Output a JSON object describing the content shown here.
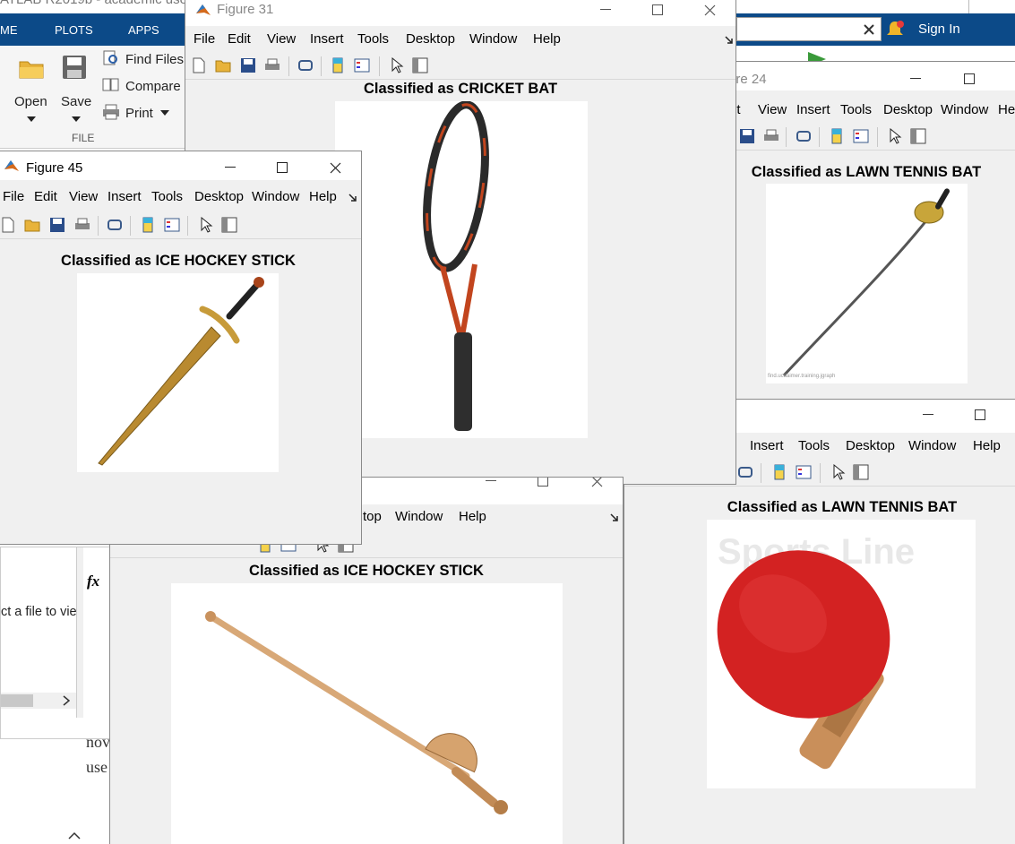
{
  "matlab": {
    "title": "ATLAB R2019b - academic use",
    "tabs": [
      "ME",
      "PLOTS",
      "APPS"
    ],
    "buttons": {
      "open": "Open",
      "save": "Save",
      "find_files": "Find Files",
      "compare": "Compare",
      "print": "Print"
    },
    "group_label": "FILE",
    "sign_in": "Sign In",
    "fx": "fx",
    "details_text": "ct a file to vie",
    "bg_text_1": "nov",
    "bg_text_2": "use"
  },
  "menus": {
    "file": "File",
    "edit": "Edit",
    "view": "View",
    "insert": "Insert",
    "tools": "Tools",
    "desktop": "Desktop",
    "window": "Window",
    "help": "Help",
    "desktop_partial": "top",
    "help_partial": "He",
    "view_partial": "it"
  },
  "figures": {
    "fig31": {
      "title": "Figure 31",
      "plot_title": "Classified as CRICKET BAT",
      "image": "tennis-racket"
    },
    "fig24": {
      "title": "ure 24",
      "plot_title": "Classified as LAWN TENNIS BAT",
      "image": "fencing-sabre",
      "watermark": "find.ucdaimer.training.jgraph"
    },
    "fig45": {
      "title": "Figure 45",
      "plot_title": "Classified as ICE HOCKEY STICK",
      "image": "longsword"
    },
    "fig_bottom": {
      "plot_title": "Classified as ICE HOCKEY STICK",
      "image": "wooden-foil"
    },
    "fig_right": {
      "plot_title": "Classified as LAWN TENNIS BAT",
      "image": "table-tennis-paddle",
      "watermark": "Sports Line"
    }
  },
  "colors": {
    "ribbon": "#0c4a88",
    "sign_in_bg": "#0c4a88",
    "paddle": "#d32222",
    "wood": "#c98f5a"
  }
}
